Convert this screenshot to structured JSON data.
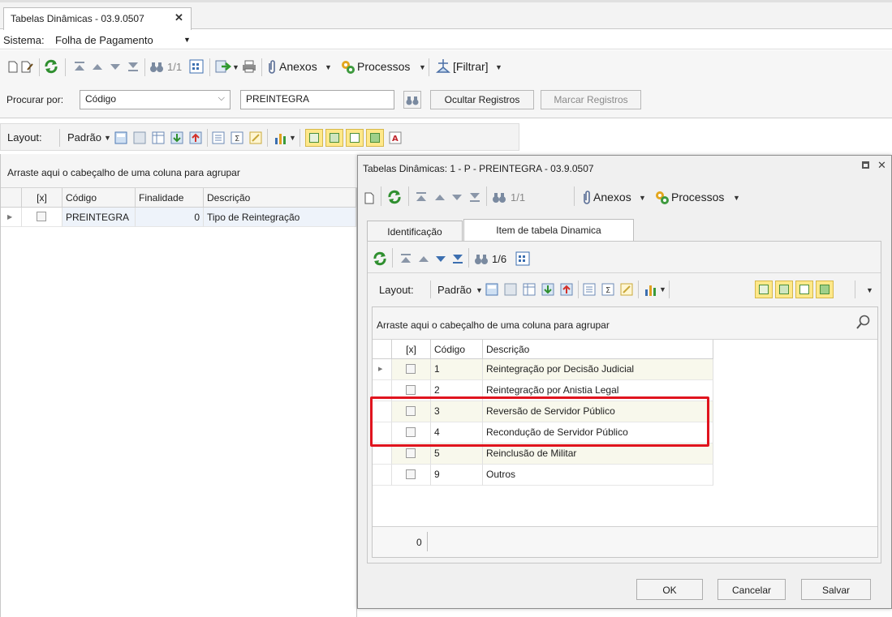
{
  "tab": {
    "title": "Tabelas Dinâmicas - 03.9.0507",
    "close": "✕"
  },
  "system": {
    "label": "Sistema:",
    "value": "Folha de Pagamento"
  },
  "toolbar": {
    "record_counter": "1/1",
    "anexos": "Anexos",
    "processos": "Processos",
    "filtrar": "[Filtrar]"
  },
  "search": {
    "label": "Procurar por:",
    "field": "Código",
    "value": "PREINTEGRA",
    "hide_button": "Ocultar Registros",
    "mark_button": "Marcar Registros"
  },
  "layout_bar": {
    "label": "Layout:",
    "preset": "Padrão"
  },
  "left_grid": {
    "group_hint": "Arraste aqui o cabeçalho de uma coluna para agrupar",
    "columns": [
      "[x]",
      "Código",
      "Finalidade",
      "Descrição"
    ],
    "rows": [
      {
        "codigo": "PREINTEGRA",
        "finalidade": "0",
        "descricao": "Tipo de Reintegração"
      }
    ]
  },
  "dialog": {
    "title": "Tabelas Dinâmicas: 1 - P - PREINTEGRA - 03.9.0507",
    "record_counter": "1/1",
    "anexos": "Anexos",
    "processos": "Processos",
    "tabs": [
      "Identificação",
      "Item de tabela Dinamica"
    ],
    "inner_counter": "1/6",
    "layout_label": "Layout:",
    "layout_preset": "Padrão",
    "group_hint": "Arraste aqui o cabeçalho de uma coluna para agrupar",
    "columns": [
      "[x]",
      "Código",
      "Descrição"
    ],
    "rows": [
      {
        "codigo": "1",
        "descricao": "Reintegração por Decisão Judicial"
      },
      {
        "codigo": "2",
        "descricao": "Reintegração por Anistia Legal"
      },
      {
        "codigo": "3",
        "descricao": "Reversão de Servidor Público"
      },
      {
        "codigo": "4",
        "descricao": "Recondução de Servidor Público"
      },
      {
        "codigo": "5",
        "descricao": "Reinclusão de Militar"
      },
      {
        "codigo": "9",
        "descricao": "Outros"
      }
    ],
    "footer_count": "0",
    "buttons": {
      "ok": "OK",
      "cancel": "Cancelar",
      "save": "Salvar"
    }
  },
  "colors": {
    "highlight": "#e0141e",
    "toolbar_yellow": "#ffe88a",
    "refresh_green": "#2f8f2f"
  }
}
